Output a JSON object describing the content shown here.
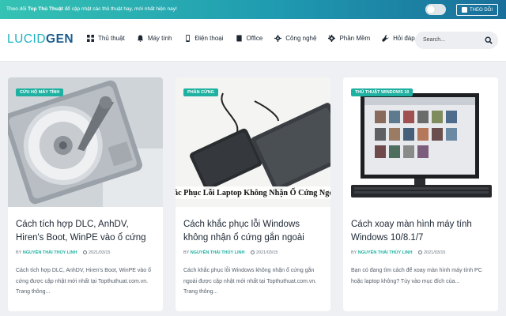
{
  "topbar": {
    "message_prefix": "Theo dõi ",
    "message_brand": "Top Thủ Thuật",
    "message_suffix": " để cập nhật các thủ thuật hay, mới nhất hiện nay!",
    "follow_label": "THEO DÕI"
  },
  "header": {
    "logo_part1": "LUCID",
    "logo_part2": "GEN",
    "nav": [
      {
        "label": "Thủ thuật",
        "icon": "grid-icon"
      },
      {
        "label": "Máy tính",
        "icon": "bell-icon"
      },
      {
        "label": "Điện thoại",
        "icon": "phone-icon"
      },
      {
        "label": "Office",
        "icon": "book-icon"
      },
      {
        "label": "Công nghệ",
        "icon": "gear-icon"
      },
      {
        "label": "Phần Mềm",
        "icon": "settings-icon"
      },
      {
        "label": "Hỏi đáp",
        "icon": "wrench-icon"
      }
    ],
    "search_placeholder": "Search..."
  },
  "cards": [
    {
      "category": "CỨU HỘ MÁY TÍNH",
      "title": "Cách tích hợp DLC, AnhDV, Hiren's Boot, WinPE vào ổ cứng",
      "by": "BY",
      "author": "NGUYỄN THÁI THỦY LINH",
      "date": "2021/03/15",
      "excerpt": "Cách tích hợp DLC, AnhDV, Hiren's Boot, WinPE vào ổ cứng được cập nhật mới nhất tại Topthuthuat.com.vn. Trang thông..."
    },
    {
      "category": "PHẦN CỨNG",
      "title": "Cách khắc phục lỗi Windows không nhận ổ cứng gắn ngoài",
      "by": "BY",
      "author": "NGUYỄN THÁI THỦY LINH",
      "date": "2021/03/15",
      "excerpt": "Cách khắc phục lỗi Windows không nhận ổ cứng gắn ngoài được cập nhật mới nhất tại Topthuthuat.com.vn. Trang thông...",
      "image_caption": "ắc Phục Lỗi Laptop Không Nhận Ổ Cứng Ngoà"
    },
    {
      "category": "THỦ THUẬT WINDOWS 10",
      "title": "Cách xoay màn hình máy tính Windows 10/8.1/7",
      "by": "BY",
      "author": "NGUYỄN THÁI THỦY LINH",
      "date": "2021/03/15",
      "excerpt": "Bạn có đang tìm cách để xoay màn hình máy tính PC hoặc laptop không? Tùy vào mục đích của..."
    }
  ],
  "colors": {
    "accent": "#1eb0a0",
    "brand_dark": "#1b5c8f",
    "logo_light": "#1eb2c0"
  }
}
